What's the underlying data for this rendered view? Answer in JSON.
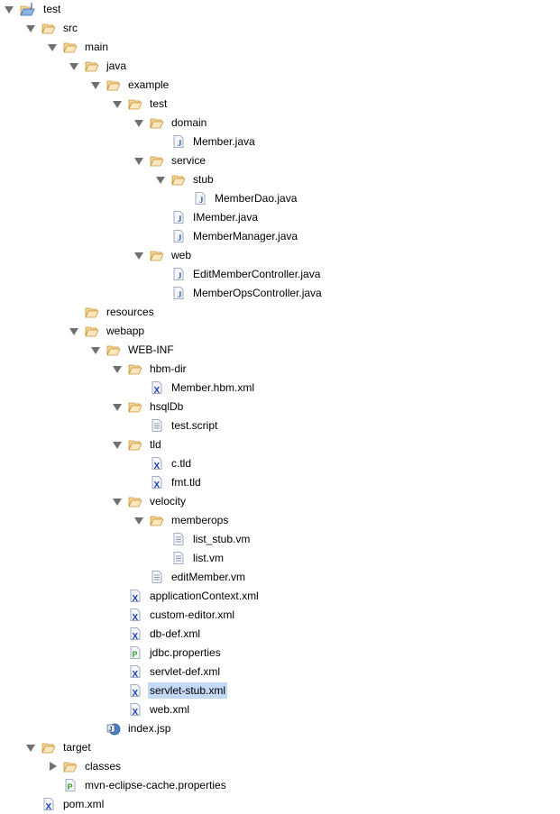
{
  "tree": {
    "selected_index": 36,
    "items": [
      {
        "label": "test",
        "depth": 0,
        "type": "project",
        "state": "open"
      },
      {
        "label": "src",
        "depth": 1,
        "type": "folder",
        "state": "open"
      },
      {
        "label": "main",
        "depth": 2,
        "type": "folder",
        "state": "open"
      },
      {
        "label": "java",
        "depth": 3,
        "type": "folder",
        "state": "open"
      },
      {
        "label": "example",
        "depth": 4,
        "type": "folder",
        "state": "open"
      },
      {
        "label": "test",
        "depth": 5,
        "type": "folder",
        "state": "open"
      },
      {
        "label": "domain",
        "depth": 6,
        "type": "folder",
        "state": "open"
      },
      {
        "label": "Member.java",
        "depth": 7,
        "type": "java",
        "state": "leaf"
      },
      {
        "label": "service",
        "depth": 6,
        "type": "folder",
        "state": "open"
      },
      {
        "label": "stub",
        "depth": 7,
        "type": "folder",
        "state": "open"
      },
      {
        "label": "MemberDao.java",
        "depth": 8,
        "type": "java",
        "state": "leaf"
      },
      {
        "label": "IMember.java",
        "depth": 7,
        "type": "java",
        "state": "leaf"
      },
      {
        "label": "MemberManager.java",
        "depth": 7,
        "type": "java",
        "state": "leaf"
      },
      {
        "label": "web",
        "depth": 6,
        "type": "folder",
        "state": "open"
      },
      {
        "label": "EditMemberController.java",
        "depth": 7,
        "type": "java",
        "state": "leaf"
      },
      {
        "label": "MemberOpsController.java",
        "depth": 7,
        "type": "java",
        "state": "leaf"
      },
      {
        "label": "resources",
        "depth": 3,
        "type": "folder",
        "state": "leaf"
      },
      {
        "label": "webapp",
        "depth": 3,
        "type": "folder",
        "state": "open"
      },
      {
        "label": "WEB-INF",
        "depth": 4,
        "type": "folder",
        "state": "open"
      },
      {
        "label": "hbm-dir",
        "depth": 5,
        "type": "folder",
        "state": "open"
      },
      {
        "label": "Member.hbm.xml",
        "depth": 6,
        "type": "xml",
        "state": "leaf"
      },
      {
        "label": "hsqlDb",
        "depth": 5,
        "type": "folder",
        "state": "open"
      },
      {
        "label": "test.script",
        "depth": 6,
        "type": "text",
        "state": "leaf"
      },
      {
        "label": "tld",
        "depth": 5,
        "type": "folder",
        "state": "open"
      },
      {
        "label": "c.tld",
        "depth": 6,
        "type": "xml",
        "state": "leaf"
      },
      {
        "label": "fmt.tld",
        "depth": 6,
        "type": "xml",
        "state": "leaf"
      },
      {
        "label": "velocity",
        "depth": 5,
        "type": "folder",
        "state": "open"
      },
      {
        "label": "memberops",
        "depth": 6,
        "type": "folder",
        "state": "open"
      },
      {
        "label": "list_stub.vm",
        "depth": 7,
        "type": "text",
        "state": "leaf"
      },
      {
        "label": "list.vm",
        "depth": 7,
        "type": "text",
        "state": "leaf"
      },
      {
        "label": "editMember.vm",
        "depth": 6,
        "type": "text",
        "state": "leaf"
      },
      {
        "label": "applicationContext.xml",
        "depth": 5,
        "type": "xml",
        "state": "leaf"
      },
      {
        "label": "custom-editor.xml",
        "depth": 5,
        "type": "xml",
        "state": "leaf"
      },
      {
        "label": "db-def.xml",
        "depth": 5,
        "type": "xml",
        "state": "leaf"
      },
      {
        "label": "jdbc.properties",
        "depth": 5,
        "type": "properties",
        "state": "leaf"
      },
      {
        "label": "servlet-def.xml",
        "depth": 5,
        "type": "xml",
        "state": "leaf"
      },
      {
        "label": "servlet-stub.xml",
        "depth": 5,
        "type": "xml",
        "state": "leaf"
      },
      {
        "label": "web.xml",
        "depth": 5,
        "type": "xml",
        "state": "leaf"
      },
      {
        "label": "index.jsp",
        "depth": 4,
        "type": "jsp",
        "state": "leaf"
      },
      {
        "label": "target",
        "depth": 1,
        "type": "folder",
        "state": "open"
      },
      {
        "label": "classes",
        "depth": 2,
        "type": "folder",
        "state": "closed"
      },
      {
        "label": "mvn-eclipse-cache.properties",
        "depth": 2,
        "type": "properties",
        "state": "leaf"
      },
      {
        "label": "pom.xml",
        "depth": 1,
        "type": "xml",
        "state": "leaf"
      }
    ]
  },
  "icons": {
    "project": "project-folder-icon",
    "folder": "folder-icon",
    "java": "java-file-icon",
    "xml": "xml-file-icon",
    "text": "text-file-icon",
    "properties": "properties-file-icon",
    "jsp": "jsp-file-icon"
  },
  "colors": {
    "selection": "#c3d9f5",
    "folder_fill": "#f7d79a",
    "folder_stroke": "#c9953a",
    "xml_x": "#1a3fb8",
    "java_j": "#2b5aa8",
    "properties_p": "#3a9a2e"
  }
}
